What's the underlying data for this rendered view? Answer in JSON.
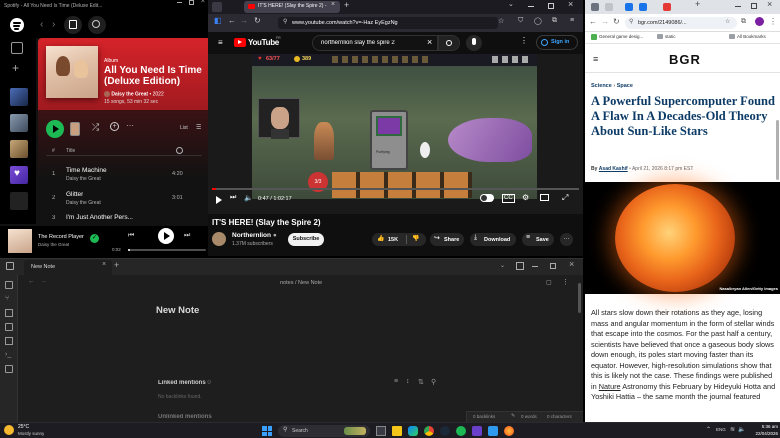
{
  "spotify": {
    "window_title": "Spotify - All You Need Is Time (Deluxe Edit...",
    "album_type": "Album",
    "album_title_line1": "All You Need Is Time",
    "album_title_line2": "(Deluxe Edition)",
    "artist": "Daisy the Great",
    "year": "2022",
    "meta": "15 songs, 53 min 32 sec",
    "list_label": "List",
    "col_hash": "#",
    "col_title": "Title",
    "tracks": [
      {
        "num": "1",
        "title": "Time Machine",
        "artist": "Daisy the Great",
        "duration": "4:20"
      },
      {
        "num": "2",
        "title": "Glitter",
        "artist": "Daisy the Great",
        "duration": "3:01"
      },
      {
        "num": "3",
        "title": "I'm Just Another Pers...",
        "artist": "",
        "duration": ""
      }
    ],
    "now_playing_title": "The Record Player S",
    "now_playing_artist": "Daisy the Great",
    "time_elapsed": "0:02",
    "progress": 0.02,
    "colors": {
      "accent": "#1db954",
      "hero": "#d6232a"
    }
  },
  "youtube": {
    "tab_title": "IT'S HERE! (Slay the Spire 2) - Yo",
    "url": "www.youtube.com/watch?v=-Haz EyEgzNg",
    "logo_text": "YouTube",
    "logo_sup": "FR",
    "search_value": "northernlion slay the spire 2",
    "signin_label": "Sign in",
    "game_hp": "63/77",
    "game_gold": "389",
    "card_name": "Purifying",
    "time_current": "0:47",
    "time_total": "1:02:17",
    "energy": "3/3",
    "progress": 0.012,
    "video_title": "IT'S HERE! (Slay the Spire 2)",
    "channel_name": "Northernlion",
    "subscribers": "1.37M subscribers",
    "subscribe_label": "Subscribe",
    "like_count": "15K",
    "share_label": "Share",
    "download_label": "Download",
    "save_label": "Save",
    "colors": {
      "accent": "#ff0000"
    }
  },
  "bgr": {
    "url": "bgr.com/2149086/...",
    "bookmark1": "General game desig...",
    "bookmark2": "static",
    "all_bookmarks": "All Bookmarks",
    "logo": "BGR",
    "breadcrumb1": "Science",
    "breadcrumb2": "Space",
    "headline": "A Powerful Supercomputer Found A Flaw In A Decades-Old Theory About Sun-Like Stars",
    "byline_by": "By",
    "author": "Asad Kashif",
    "date": "April 21, 2026 8:17 pm EST",
    "photo_credit": "Nasa/bryan Allen/Getty Images",
    "body": "All stars slow down their rotations as they age, losing mass and angular momentum in the form of stellar winds that escape into the cosmos. For the past half a century, scientists have believed that once a gaseous body slows down enough, its poles start moving faster than its equator. However, high-resolution simulations show that this is likely not the case. These findings were published in ",
    "body_link": "Nature",
    "body_tail": "Astronomy this February by Hideyuki Hotta and Yoshiki Hattia – the same month the journal featured"
  },
  "notes": {
    "tab_label": "New Note",
    "breadcrumb": "notes / New Note",
    "title": "New Note",
    "linked_mentions_label": "Linked mentions",
    "linked_mentions_count": "0",
    "no_backlinks": "No backlinks found.",
    "unlinked_mentions_label": "Unlinked mentions",
    "status_backlinks": "0 backlinks",
    "status_words": "0 words",
    "status_chars": "0 characters"
  },
  "taskbar": {
    "temperature": "25°C",
    "weather": "Mostly sunny",
    "search_placeholder": "Search",
    "time": "5:36 am",
    "date": "22/04/2026",
    "language": "ENG"
  }
}
